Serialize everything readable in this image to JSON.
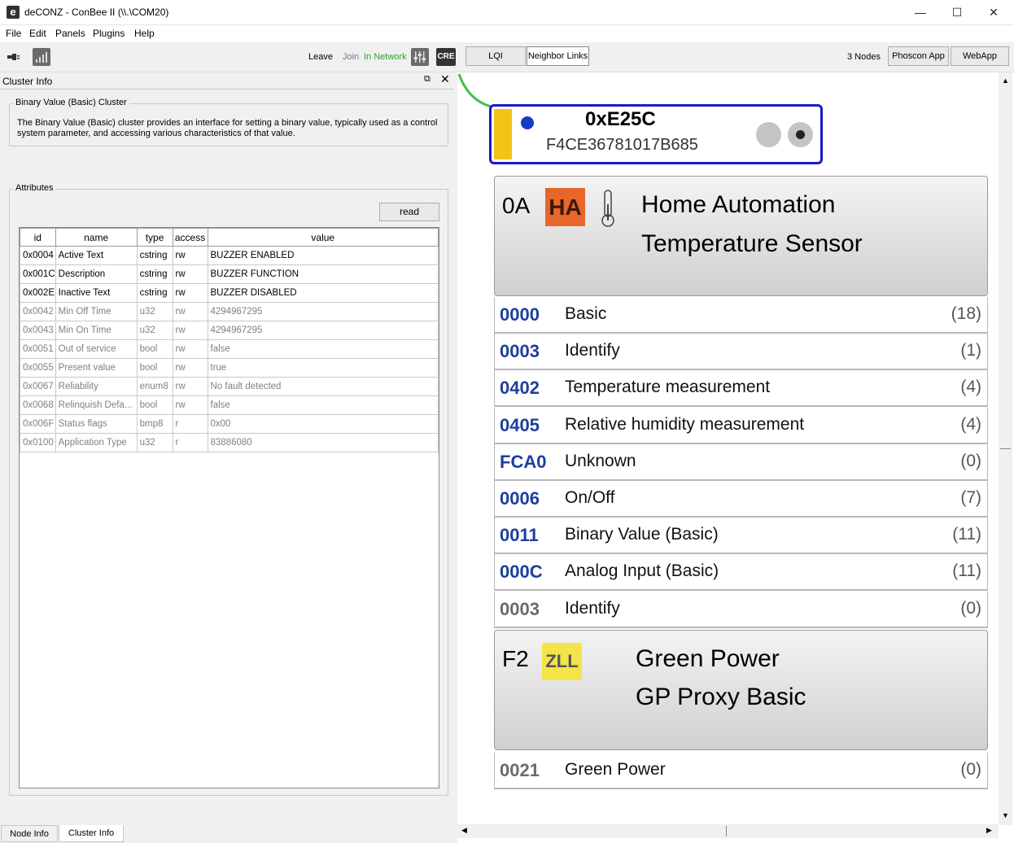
{
  "window": {
    "title": "deCONZ - ConBee II (\\\\.\\COM20)",
    "app_icon": "e",
    "minimize": "—",
    "maximize": "☐",
    "close": "✕"
  },
  "menu": [
    "File",
    "Edit",
    "Panels",
    "Plugins",
    "Help"
  ],
  "toolbar": {
    "leave": "Leave",
    "join": "Join",
    "network_status": "In Network",
    "network_status_color": "#2ca02c",
    "cre_label": "CRE",
    "lqi": "LQI",
    "neighbor_links": "Neighbor Links",
    "nodes_count": "3 Nodes",
    "phoscon_app": "Phoscon App",
    "webapp": "WebApp"
  },
  "cluster_info": {
    "dock_title": "Cluster Info",
    "group_title": "Binary Value (Basic) Cluster",
    "description": "The Binary Value (Basic) cluster provides an interface for setting a binary value, typically used as a control system parameter, and accessing various characteristics of that value.",
    "attributes_title": "Attributes",
    "read_button": "read",
    "columns": [
      "id",
      "name",
      "type",
      "access",
      "value"
    ],
    "rows": [
      {
        "id": "0x0004",
        "name": "Active Text",
        "type": "cstring",
        "access": "rw",
        "value": "BUZZER ENABLED",
        "active": true
      },
      {
        "id": "0x001C",
        "name": "Description",
        "type": "cstring",
        "access": "rw",
        "value": "BUZZER FUNCTION",
        "active": true
      },
      {
        "id": "0x002E",
        "name": "Inactive Text",
        "type": "cstring",
        "access": "rw",
        "value": "BUZZER DISABLED",
        "active": true
      },
      {
        "id": "0x0042",
        "name": "Min Off Time",
        "type": "u32",
        "access": "rw",
        "value": "4294967295",
        "active": false
      },
      {
        "id": "0x0043",
        "name": "Min On Time",
        "type": "u32",
        "access": "rw",
        "value": "4294967295",
        "active": false
      },
      {
        "id": "0x0051",
        "name": "Out of service",
        "type": "bool",
        "access": "rw",
        "value": "false",
        "active": false
      },
      {
        "id": "0x0055",
        "name": "Present value",
        "type": "bool",
        "access": "rw",
        "value": "true",
        "active": false
      },
      {
        "id": "0x0067",
        "name": "Reliability",
        "type": "enum8",
        "access": "rw",
        "value": "No fault detected",
        "active": false
      },
      {
        "id": "0x0068",
        "name": "Relinquish Defa...",
        "type": "bool",
        "access": "rw",
        "value": "false",
        "active": false
      },
      {
        "id": "0x006F",
        "name": "Status flags",
        "type": "bmp8",
        "access": "r",
        "value": "0x00",
        "active": false
      },
      {
        "id": "0x0100",
        "name": "Application Type",
        "type": "u32",
        "access": "r",
        "value": "83886080",
        "active": false
      }
    ],
    "tabs": [
      "Node Info",
      "Cluster Info"
    ]
  },
  "node": {
    "nwk_address": "0xE25C",
    "mac_address": "F4CE36781017B685",
    "endpoints": [
      {
        "id": "0A",
        "profile_badge": "HA",
        "badge_color": "#e8662a",
        "profile": "Home Automation",
        "device": "Temperature Sensor",
        "clusters": [
          {
            "id": "0000",
            "name": "Basic",
            "count": "(18)",
            "server": true
          },
          {
            "id": "0003",
            "name": "Identify",
            "count": "(1)",
            "server": true
          },
          {
            "id": "0402",
            "name": "Temperature measurement",
            "count": "(4)",
            "server": true
          },
          {
            "id": "0405",
            "name": "Relative humidity measurement",
            "count": "(4)",
            "server": true
          },
          {
            "id": "FCA0",
            "name": "Unknown",
            "count": "(0)",
            "server": true
          },
          {
            "id": "0006",
            "name": "On/Off",
            "count": "(7)",
            "server": true
          },
          {
            "id": "0011",
            "name": "Binary Value (Basic)",
            "count": "(11)",
            "server": true
          },
          {
            "id": "000C",
            "name": "Analog Input (Basic)",
            "count": "(11)",
            "server": true
          },
          {
            "id": "0003",
            "name": "Identify",
            "count": "(0)",
            "server": false
          }
        ]
      },
      {
        "id": "F2",
        "profile_badge": "ZLL",
        "badge_color": "#f5e34a",
        "profile": "Green Power",
        "device": "GP Proxy Basic",
        "clusters": [
          {
            "id": "0021",
            "name": "Green Power",
            "count": "(0)",
            "server": false
          }
        ]
      }
    ]
  }
}
